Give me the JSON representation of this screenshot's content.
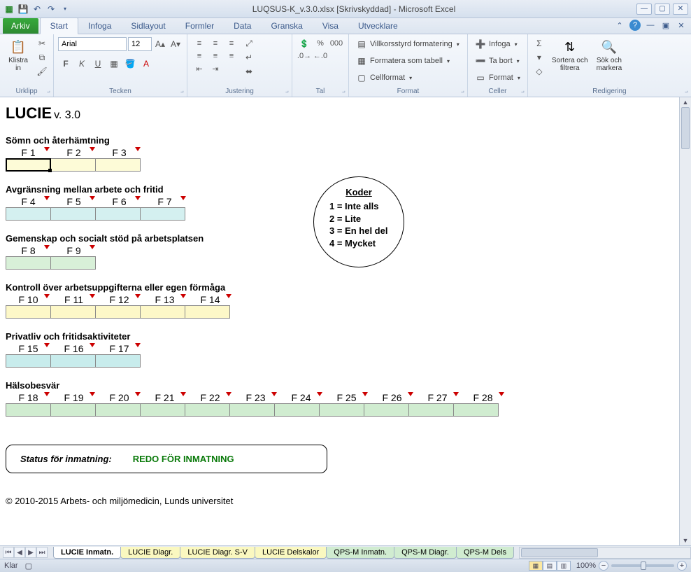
{
  "titlebar": {
    "title": "LUQSUS-K_v.3.0.xlsx  [Skrivskyddad]  -  Microsoft Excel"
  },
  "tabs": {
    "file": "Arkiv",
    "items": [
      "Start",
      "Infoga",
      "Sidlayout",
      "Formler",
      "Data",
      "Granska",
      "Visa",
      "Utvecklare"
    ],
    "active": 0
  },
  "ribbon": {
    "clipboard": {
      "label": "Urklipp",
      "paste": "Klistra\nin"
    },
    "font": {
      "label": "Tecken",
      "name": "Arial",
      "size": "12"
    },
    "alignment": {
      "label": "Justering"
    },
    "number": {
      "label": "Tal"
    },
    "styles": {
      "label": "Format",
      "cond": "Villkorsstyrd formatering",
      "table": "Formatera som tabell",
      "cell": "Cellformat"
    },
    "cells": {
      "label": "Celler",
      "insert": "Infoga",
      "delete": "Ta bort",
      "format": "Format"
    },
    "editing": {
      "label": "Redigering",
      "sort": "Sortera och\nfiltrera",
      "find": "Sök och\nmarkera"
    }
  },
  "sheet": {
    "title": "LUCIE",
    "version": "v. 3.0",
    "sections": [
      {
        "title": "Sömn och återhämtning",
        "fields": [
          "F 1",
          "F 2",
          "F 3"
        ],
        "color": "c-yellow",
        "selected": 0
      },
      {
        "title": "Avgränsning mellan arbete och fritid",
        "fields": [
          "F 4",
          "F 5",
          "F 6",
          "F 7"
        ],
        "color": "c-blue"
      },
      {
        "title": "Gemenskap och socialt stöd på arbetsplatsen",
        "fields": [
          "F 8",
          "F 9"
        ],
        "color": "c-green"
      },
      {
        "title": "Kontroll över arbetsuppgifterna eller egen förmåga",
        "fields": [
          "F 10",
          "F 11",
          "F 12",
          "F 13",
          "F 14"
        ],
        "color": "c-yellow2"
      },
      {
        "title": "Privatliv och fritidsaktiviteter",
        "fields": [
          "F 15",
          "F 16",
          "F 17"
        ],
        "color": "c-blue2"
      },
      {
        "title": "Hälsobesvär",
        "fields": [
          "F 18",
          "F 19",
          "F 20",
          "F 21",
          "F 22",
          "F 23",
          "F 24",
          "F 25",
          "F 26",
          "F 27",
          "F 28"
        ],
        "color": "c-green2"
      }
    ],
    "koder": {
      "head": "Koder",
      "lines": [
        "1 = Inte alls",
        "2 = Lite",
        "3 = En hel del",
        "4 = Mycket"
      ]
    },
    "status": {
      "label": "Status för inmatning:",
      "value": "REDO FÖR INMATNING"
    },
    "copyright": "© 2010-2015 Arbets- och miljömedicin, Lunds universitet"
  },
  "sheettabs": [
    {
      "label": "LUCIE Inmatn.",
      "cls": "active"
    },
    {
      "label": "LUCIE Diagr.",
      "cls": "yellow"
    },
    {
      "label": "LUCIE Diagr. S-V",
      "cls": "yellow"
    },
    {
      "label": "LUCIE Delskalor",
      "cls": "yellow"
    },
    {
      "label": "QPS-M Inmatn.",
      "cls": "green"
    },
    {
      "label": "QPS-M Diagr.",
      "cls": "green"
    },
    {
      "label": "QPS-M Dels",
      "cls": "green"
    }
  ],
  "statusbar": {
    "ready": "Klar",
    "zoom": "100%"
  }
}
